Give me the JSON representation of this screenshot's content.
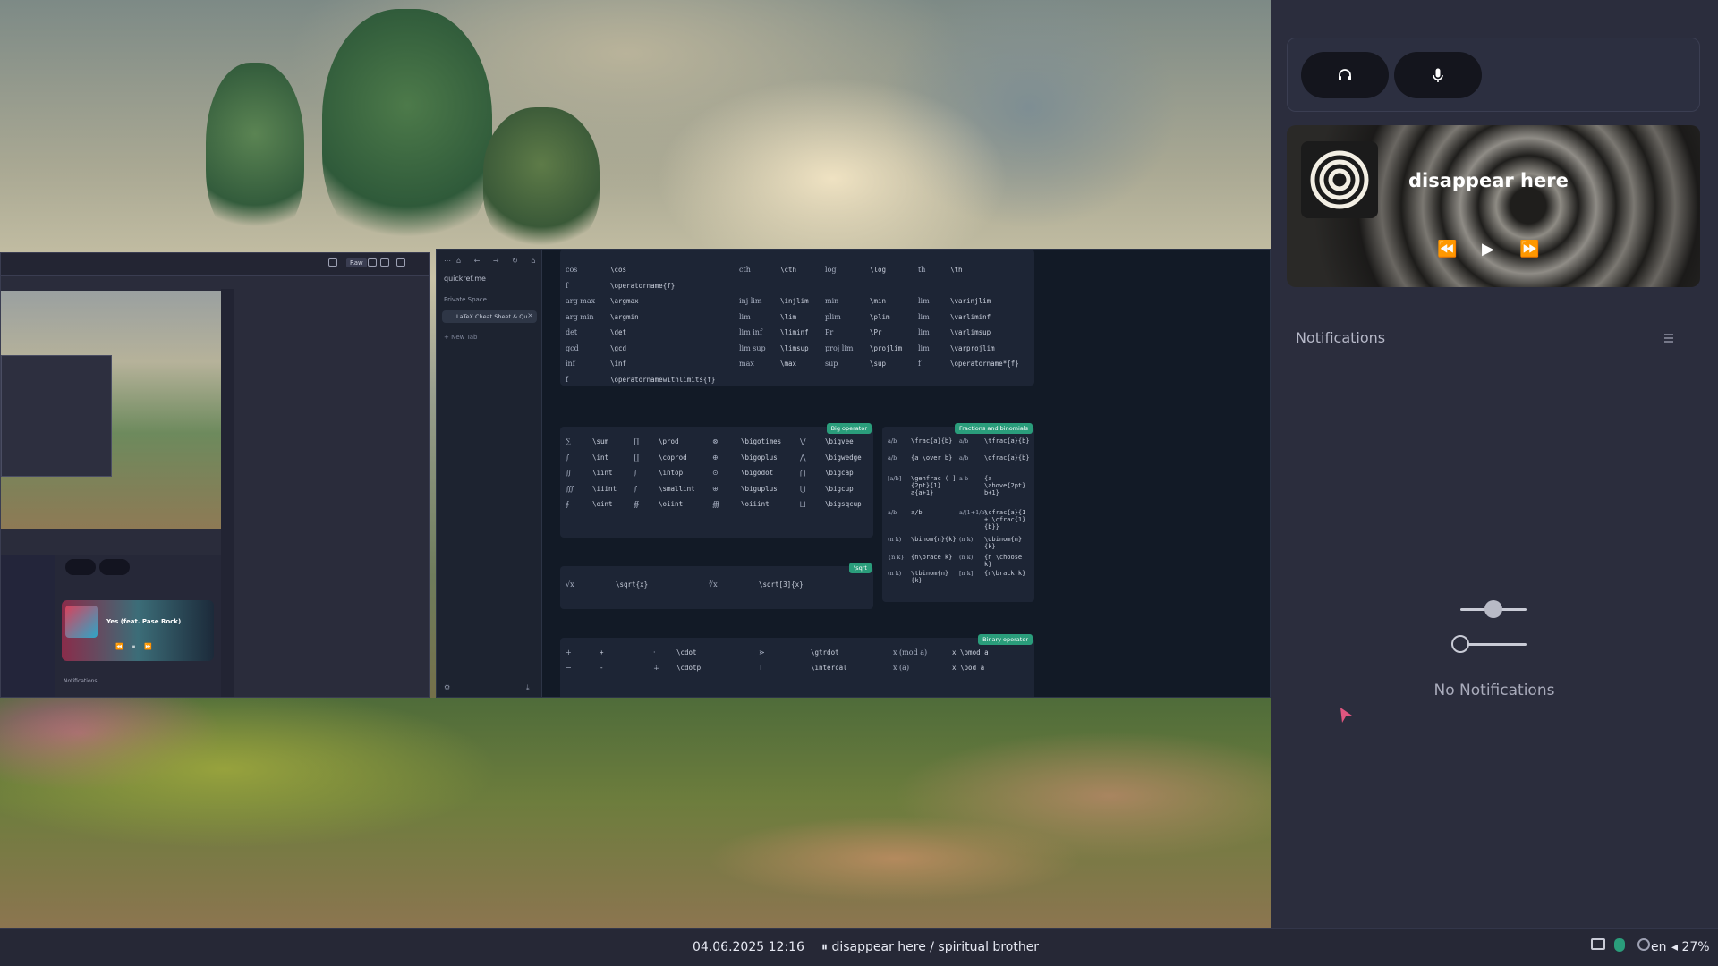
{
  "status_bar": {
    "datetime": "04.06.2025 12:16",
    "media": "⏸ disappear here / spiritual brother",
    "language": "en",
    "volume": "◂ 27%"
  },
  "quick_buttons": {
    "headphones_icon": "headphones-icon",
    "microphone_icon": "microphone-icon"
  },
  "player": {
    "title": "disappear here",
    "prev": "⏪",
    "play": "▶",
    "next": "⏩"
  },
  "notifications": {
    "title": "Notifications",
    "empty_text": "No Notifications",
    "slider_1_level": 0.5,
    "slider_2_level": 0.0
  },
  "browser": {
    "url": "quickref.me",
    "section": "Private Space",
    "tab": "LaTeX Cheat Sheet & Qu",
    "new_tab": "+ New Tab"
  },
  "cheatsheet": {
    "top_rows": [
      [
        "cos",
        "\\cos",
        "cth",
        "\\cth",
        "log",
        "\\log",
        "th",
        "\\th"
      ],
      [
        "f",
        "\\operatorname{f}",
        "",
        "",
        "",
        "",
        "",
        ""
      ],
      [
        "arg max",
        "\\argmax",
        "inj lim",
        "\\injlim",
        "min",
        "\\min",
        "lim",
        "\\varinjlim"
      ],
      [
        "arg min",
        "\\argmin",
        "lim",
        "\\lim",
        "plim",
        "\\plim",
        "lim",
        "\\varliminf"
      ],
      [
        "det",
        "\\det",
        "lim inf",
        "\\liminf",
        "Pr",
        "\\Pr",
        "lim",
        "\\varlimsup"
      ],
      [
        "gcd",
        "\\gcd",
        "lim sup",
        "\\limsup",
        "proj lim",
        "\\projlim",
        "lim",
        "\\varprojlim"
      ],
      [
        "inf",
        "\\inf",
        "max",
        "\\max",
        "sup",
        "\\sup",
        "f",
        "\\operatorname*{f}"
      ],
      [
        "f",
        "\\operatornamewithlimits{f}",
        "",
        "",
        "",
        "",
        "",
        ""
      ]
    ],
    "big_operator": {
      "badge": "Big operator",
      "rows": [
        [
          "∑",
          "\\sum",
          "∏",
          "\\prod",
          "⊗",
          "\\bigotimes",
          "⋁",
          "\\bigvee"
        ],
        [
          "∫",
          "\\int",
          "∐",
          "\\coprod",
          "⊕",
          "\\bigoplus",
          "⋀",
          "\\bigwedge"
        ],
        [
          "∬",
          "\\iint",
          "∫",
          "\\intop",
          "⊙",
          "\\bigodot",
          "⋂",
          "\\bigcap"
        ],
        [
          "∭",
          "\\iiint",
          "∫",
          "\\smallint",
          "⊎",
          "\\biguplus",
          "⋃",
          "\\bigcup"
        ],
        [
          "∮",
          "\\oint",
          "∯",
          "\\oiint",
          "∰",
          "\\oiiint",
          "⨆",
          "\\bigsqcup"
        ]
      ]
    },
    "sqrt": {
      "badge": "\\sqrt",
      "row": [
        "√x",
        "\\sqrt{x}",
        "∛x",
        "\\sqrt[3]{x}"
      ]
    },
    "fractions": {
      "badge": "Fractions and binomials",
      "rows": [
        [
          "a/b",
          "\\frac{a}{b}",
          "a/b",
          "\\tfrac{a}{b}"
        ],
        [
          "a/b",
          "{a \\over b}",
          "a/b",
          "\\dfrac{a}{b}"
        ],
        [
          "[a/b]",
          "\\genfrac ( ] {2pt}{1} a{a+1}",
          "a b",
          "{a \\above{2pt} b+1}"
        ],
        [
          "a/b",
          "a/b",
          "a/(1+1/b)",
          "\\cfrac{a}{1 + \\cfrac{1}{b}}"
        ],
        [
          "(n k)",
          "\\binom{n}{k}",
          "(n k)",
          "\\dbinom{n}{k}"
        ],
        [
          "{n k}",
          "{n\\brace k}",
          "(n k)",
          "{n \\choose k}"
        ],
        [
          "(n k)",
          "\\tbinom{n}{k}",
          "[n k]",
          "{n\\brack k}"
        ]
      ]
    },
    "binary": {
      "badge": "Binary operator",
      "rows": [
        [
          "+",
          "+",
          "·",
          "\\cdot",
          "⋗",
          "\\gtrdot",
          "x (mod a)",
          "x \\pmod a"
        ],
        [
          "−",
          "-",
          "∔",
          "\\cdotp",
          "⊺",
          "\\intercal",
          "x (a)",
          "x \\pod a"
        ]
      ]
    }
  },
  "mini_window": {
    "song": "Yes (feat. Pase Rock)",
    "notifications": "Notifications",
    "toolbar_raw": "Raw"
  },
  "colors": {
    "accent_badge": "#2a9d7b",
    "panel_bg": "#2b2d3d",
    "statusbar_bg": "#262836"
  }
}
